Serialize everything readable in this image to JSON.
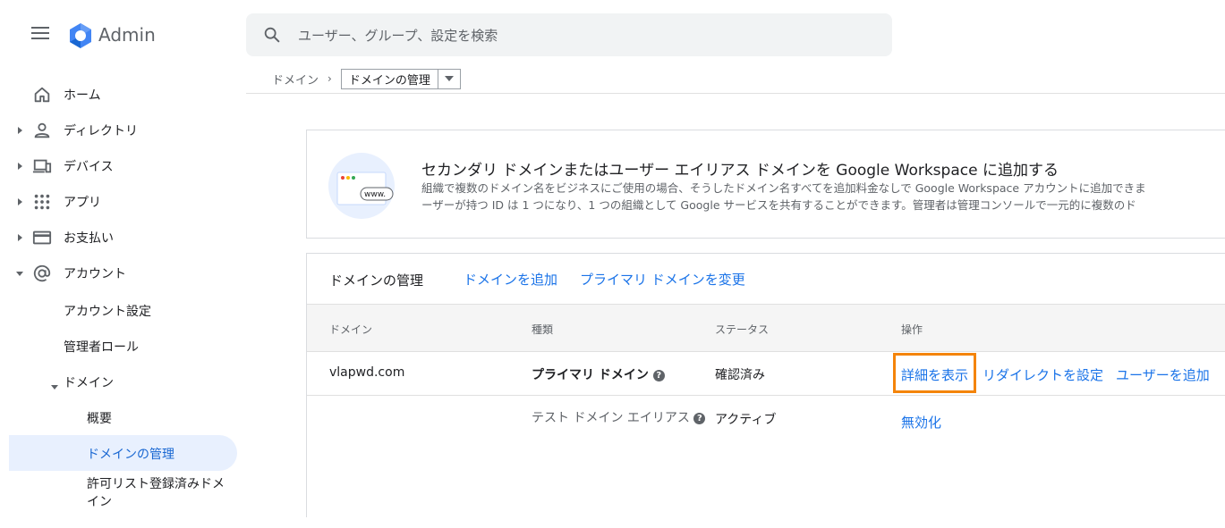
{
  "header": {
    "app_title": "Admin",
    "search_placeholder": "ユーザー、グループ、設定を検索"
  },
  "breadcrumb": {
    "parent": "ドメイン",
    "separator": "›",
    "current": "ドメインの管理"
  },
  "sidebar": {
    "items": [
      {
        "label": "ホーム",
        "icon": "home-icon"
      },
      {
        "label": "ディレクトリ",
        "icon": "person-icon"
      },
      {
        "label": "デバイス",
        "icon": "devices-icon"
      },
      {
        "label": "アプリ",
        "icon": "apps-grid-icon"
      },
      {
        "label": "お支払い",
        "icon": "credit-card-icon"
      },
      {
        "label": "アカウント",
        "icon": "at-sign-icon"
      }
    ],
    "account_sub": [
      "アカウント設定",
      "管理者ロール",
      "ドメイン"
    ],
    "domain_sub": [
      "概要",
      "ドメインの管理",
      "許可リスト登録済みドメイン"
    ]
  },
  "promo": {
    "title": "セカンダリ ドメインまたはユーザー エイリアス ドメインを Google Workspace に追加する",
    "desc_line1": "組織で複数のドメイン名をビジネスにご使用の場合、そうしたドメイン名すべてを追加料金なしで Google Workspace アカウントに追加できま",
    "desc_line2": "ーザーが持つ ID は 1 つになり、1 つの組織として Google サービスを共有することができます。管理者は管理コンソールで一元的に複数のド",
    "image_text": "www."
  },
  "domains": {
    "title": "ドメインの管理",
    "add_link": "ドメインを追加",
    "change_primary_link": "プライマリ ドメインを変更",
    "columns": [
      "ドメイン",
      "種類",
      "ステータス",
      "操作"
    ],
    "rows": [
      {
        "domain": "vlapwd.com",
        "type": "プライマリ ドメイン",
        "status": "確認済み",
        "actions": [
          "詳細を表示",
          "リダイレクトを設定",
          "ユーザーを追加"
        ]
      },
      {
        "domain": "",
        "type": "テスト ドメイン エイリアス",
        "status": "アクティブ",
        "actions": [
          "無効化"
        ]
      }
    ],
    "help_glyph": "?"
  },
  "colors": {
    "accent": "#1a73e8",
    "highlight": "#f4840a",
    "active_nav_bg": "#e8f0fe"
  }
}
